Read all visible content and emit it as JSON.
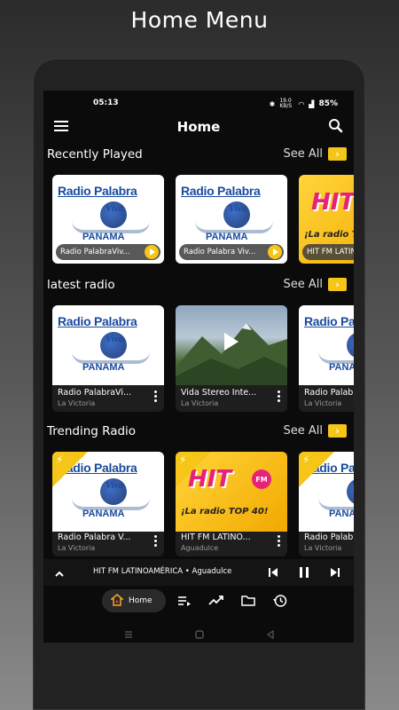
{
  "caption": "Home Menu",
  "status": {
    "time": "05:13",
    "net": "19.0 KB/S",
    "battery": "85%"
  },
  "appbar": {
    "title": "Home"
  },
  "sections": [
    {
      "title": "Recently Played",
      "see_all": "See All",
      "items": [
        {
          "name": "Radio PalabraViv...",
          "art": "radio-palabra-viva-logo"
        },
        {
          "name": "Radio Palabra Viv...",
          "art": "radio-palabra-viva-logo"
        },
        {
          "name": "HIT FM LATIN",
          "art": "hit-fm-logo"
        }
      ]
    },
    {
      "title": "latest radio",
      "see_all": "See All",
      "items": [
        {
          "name": "Radio PalabraVi...",
          "location": "La Victoria",
          "art": "radio-palabra-viva-logo"
        },
        {
          "name": "Vida Stereo Inte...",
          "location": "La Victoria",
          "art": "mountain-photo"
        },
        {
          "name": "Radio Palab",
          "location": "La Victoria",
          "art": "radio-palabra-viva-logo"
        }
      ]
    },
    {
      "title": "Trending Radio",
      "see_all": "See All",
      "items": [
        {
          "name": "Radio Palabra V...",
          "location": "La Victoria",
          "art": "radio-palabra-viva-logo"
        },
        {
          "name": "HIT FM LATINO...",
          "location": "Aguadulce",
          "art": "hit-fm-logo"
        },
        {
          "name": "Radio Palab",
          "location": "La Victoria",
          "art": "radio-palabra-viva-logo"
        }
      ]
    }
  ],
  "logo_text": {
    "rpv_line1": "Radio Palabra",
    "rpv_line2": "Viva",
    "rpv_line3": "PANAMA",
    "hit": "HIT",
    "fm": "FM",
    "hit_tag": "¡La radio TOP 40!"
  },
  "now_playing": {
    "text": "HIT FM LATINOAMÉRICA • Aguadulce"
  },
  "bottom_nav": {
    "home_label": "Home",
    "icons": [
      "queue-icon",
      "trending-icon",
      "folder-icon",
      "history-icon"
    ]
  },
  "colors": {
    "accent": "#f5c518",
    "background": "#0b0b0b"
  }
}
